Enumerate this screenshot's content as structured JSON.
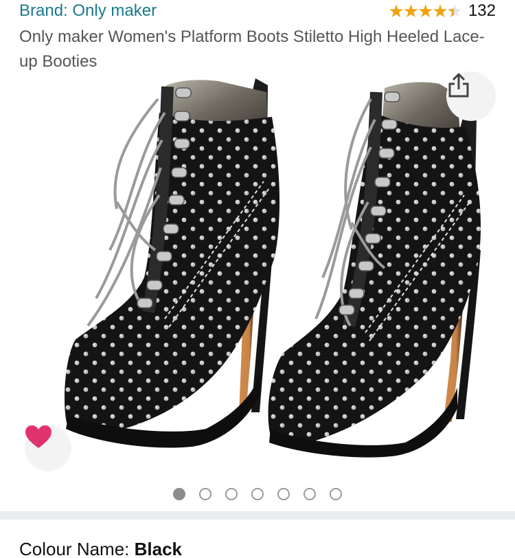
{
  "product": {
    "brand_text": "Brand: Only maker",
    "rating_value": 4.5,
    "review_count": "132",
    "title": "Only maker Women's Platform Boots Stiletto High Heeled Lace-up Booties"
  },
  "gallery": {
    "image_count": 7,
    "active_index": 0
  },
  "variant": {
    "label": "Colour Name: ",
    "value": "Black"
  },
  "colors": {
    "brand_link": "#1a7a8c",
    "star": "#f0a30a",
    "heart": "#e0336e"
  },
  "icons": [
    "star-icon",
    "share-icon",
    "heart-icon"
  ]
}
